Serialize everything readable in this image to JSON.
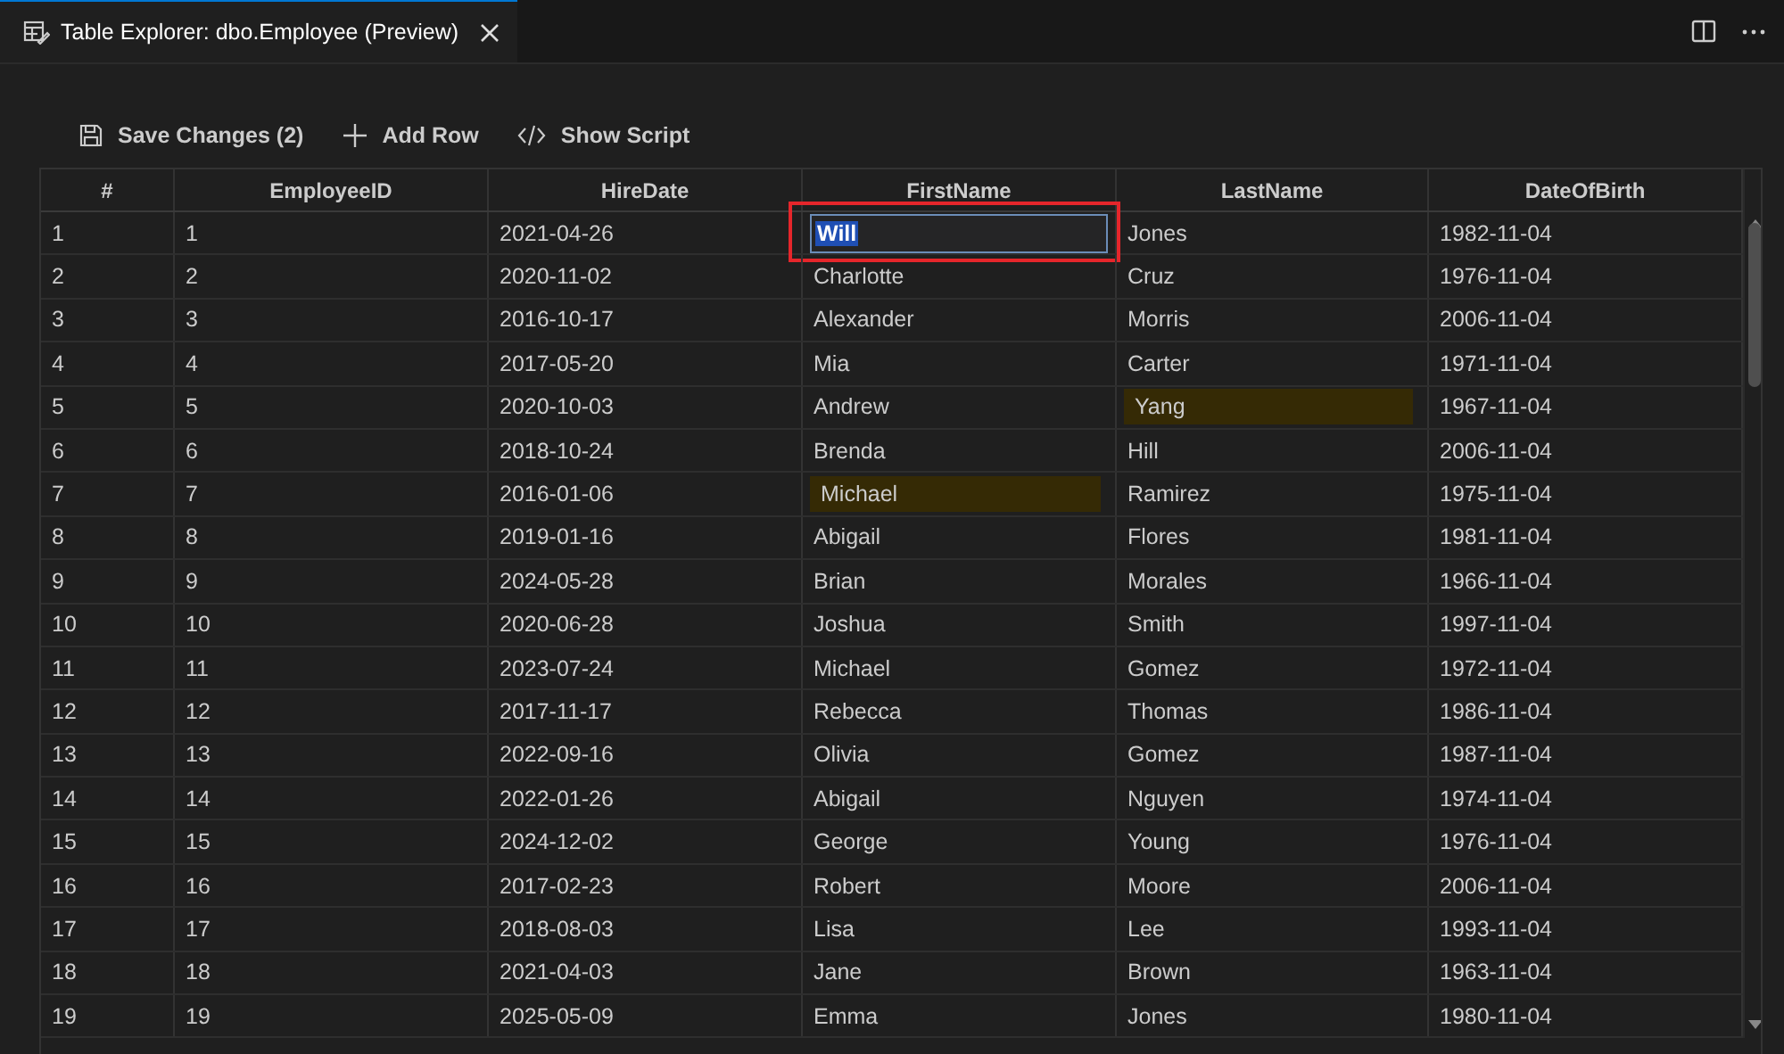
{
  "tab": {
    "title": "Table Explorer: dbo.Employee (Preview)",
    "selected": true
  },
  "toolbar": [
    {
      "kind": "save",
      "label": "Save Changes (2)"
    },
    {
      "kind": "add",
      "label": "Add Row"
    },
    {
      "kind": "script",
      "label": "Show Script"
    }
  ],
  "table": {
    "columns": [
      "#",
      "EmployeeID",
      "HireDate",
      "FirstName",
      "LastName",
      "DateOfBirth"
    ],
    "rows": [
      [
        {
          "text": "1",
          "kind": "plain"
        },
        {
          "text": "1",
          "kind": "plain"
        },
        {
          "text": "2021-04-26",
          "kind": "plain"
        },
        {
          "text": "Will",
          "kind": "editing",
          "annotated": true
        },
        {
          "text": "Jones",
          "kind": "plain"
        },
        {
          "text": "1982-11-04",
          "kind": "plain"
        }
      ],
      [
        {
          "text": "2",
          "kind": "plain"
        },
        {
          "text": "2",
          "kind": "plain"
        },
        {
          "text": "2020-11-02",
          "kind": "plain"
        },
        {
          "text": "Charlotte",
          "kind": "plain"
        },
        {
          "text": "Cruz",
          "kind": "plain"
        },
        {
          "text": "1976-11-04",
          "kind": "plain"
        }
      ],
      [
        {
          "text": "3",
          "kind": "plain"
        },
        {
          "text": "3",
          "kind": "plain"
        },
        {
          "text": "2016-10-17",
          "kind": "plain"
        },
        {
          "text": "Alexander",
          "kind": "plain"
        },
        {
          "text": "Morris",
          "kind": "plain"
        },
        {
          "text": "2006-11-04",
          "kind": "plain"
        }
      ],
      [
        {
          "text": "4",
          "kind": "plain"
        },
        {
          "text": "4",
          "kind": "plain"
        },
        {
          "text": "2017-05-20",
          "kind": "plain"
        },
        {
          "text": "Mia",
          "kind": "plain"
        },
        {
          "text": "Carter",
          "kind": "plain"
        },
        {
          "text": "1971-11-04",
          "kind": "plain"
        }
      ],
      [
        {
          "text": "5",
          "kind": "plain"
        },
        {
          "text": "5",
          "kind": "plain"
        },
        {
          "text": "2020-10-03",
          "kind": "plain"
        },
        {
          "text": "Andrew",
          "kind": "plain"
        },
        {
          "text": "Yang",
          "kind": "modified"
        },
        {
          "text": "1967-11-04",
          "kind": "plain"
        }
      ],
      [
        {
          "text": "6",
          "kind": "plain"
        },
        {
          "text": "6",
          "kind": "plain"
        },
        {
          "text": "2018-10-24",
          "kind": "plain"
        },
        {
          "text": "Brenda",
          "kind": "plain"
        },
        {
          "text": "Hill",
          "kind": "plain"
        },
        {
          "text": "2006-11-04",
          "kind": "plain"
        }
      ],
      [
        {
          "text": "7",
          "kind": "plain"
        },
        {
          "text": "7",
          "kind": "plain"
        },
        {
          "text": "2016-01-06",
          "kind": "plain"
        },
        {
          "text": "Michael",
          "kind": "modified"
        },
        {
          "text": "Ramirez",
          "kind": "plain"
        },
        {
          "text": "1975-11-04",
          "kind": "plain"
        }
      ],
      [
        {
          "text": "8",
          "kind": "plain"
        },
        {
          "text": "8",
          "kind": "plain"
        },
        {
          "text": "2019-01-16",
          "kind": "plain"
        },
        {
          "text": "Abigail",
          "kind": "plain"
        },
        {
          "text": "Flores",
          "kind": "plain"
        },
        {
          "text": "1981-11-04",
          "kind": "plain"
        }
      ],
      [
        {
          "text": "9",
          "kind": "plain"
        },
        {
          "text": "9",
          "kind": "plain"
        },
        {
          "text": "2024-05-28",
          "kind": "plain"
        },
        {
          "text": "Brian",
          "kind": "plain"
        },
        {
          "text": "Morales",
          "kind": "plain"
        },
        {
          "text": "1966-11-04",
          "kind": "plain"
        }
      ],
      [
        {
          "text": "10",
          "kind": "plain"
        },
        {
          "text": "10",
          "kind": "plain"
        },
        {
          "text": "2020-06-28",
          "kind": "plain"
        },
        {
          "text": "Joshua",
          "kind": "plain"
        },
        {
          "text": "Smith",
          "kind": "plain"
        },
        {
          "text": "1997-11-04",
          "kind": "plain"
        }
      ],
      [
        {
          "text": "11",
          "kind": "plain"
        },
        {
          "text": "11",
          "kind": "plain"
        },
        {
          "text": "2023-07-24",
          "kind": "plain"
        },
        {
          "text": "Michael",
          "kind": "plain"
        },
        {
          "text": "Gomez",
          "kind": "plain"
        },
        {
          "text": "1972-11-04",
          "kind": "plain"
        }
      ],
      [
        {
          "text": "12",
          "kind": "plain"
        },
        {
          "text": "12",
          "kind": "plain"
        },
        {
          "text": "2017-11-17",
          "kind": "plain"
        },
        {
          "text": "Rebecca",
          "kind": "plain"
        },
        {
          "text": "Thomas",
          "kind": "plain"
        },
        {
          "text": "1986-11-04",
          "kind": "plain"
        }
      ],
      [
        {
          "text": "13",
          "kind": "plain"
        },
        {
          "text": "13",
          "kind": "plain"
        },
        {
          "text": "2022-09-16",
          "kind": "plain"
        },
        {
          "text": "Olivia",
          "kind": "plain"
        },
        {
          "text": "Gomez",
          "kind": "plain"
        },
        {
          "text": "1987-11-04",
          "kind": "plain"
        }
      ],
      [
        {
          "text": "14",
          "kind": "plain"
        },
        {
          "text": "14",
          "kind": "plain"
        },
        {
          "text": "2022-01-26",
          "kind": "plain"
        },
        {
          "text": "Abigail",
          "kind": "plain"
        },
        {
          "text": "Nguyen",
          "kind": "plain"
        },
        {
          "text": "1974-11-04",
          "kind": "plain"
        }
      ],
      [
        {
          "text": "15",
          "kind": "plain"
        },
        {
          "text": "15",
          "kind": "plain"
        },
        {
          "text": "2024-12-02",
          "kind": "plain"
        },
        {
          "text": "George",
          "kind": "plain"
        },
        {
          "text": "Young",
          "kind": "plain"
        },
        {
          "text": "1976-11-04",
          "kind": "plain"
        }
      ],
      [
        {
          "text": "16",
          "kind": "plain"
        },
        {
          "text": "16",
          "kind": "plain"
        },
        {
          "text": "2017-02-23",
          "kind": "plain"
        },
        {
          "text": "Robert",
          "kind": "plain"
        },
        {
          "text": "Moore",
          "kind": "plain"
        },
        {
          "text": "2006-11-04",
          "kind": "plain"
        }
      ],
      [
        {
          "text": "17",
          "kind": "plain"
        },
        {
          "text": "17",
          "kind": "plain"
        },
        {
          "text": "2018-08-03",
          "kind": "plain"
        },
        {
          "text": "Lisa",
          "kind": "plain"
        },
        {
          "text": "Lee",
          "kind": "plain"
        },
        {
          "text": "1993-11-04",
          "kind": "plain"
        }
      ],
      [
        {
          "text": "18",
          "kind": "plain"
        },
        {
          "text": "18",
          "kind": "plain"
        },
        {
          "text": "2021-04-03",
          "kind": "plain"
        },
        {
          "text": "Jane",
          "kind": "plain"
        },
        {
          "text": "Brown",
          "kind": "plain"
        },
        {
          "text": "1963-11-04",
          "kind": "plain"
        }
      ],
      [
        {
          "text": "19",
          "kind": "plain"
        },
        {
          "text": "19",
          "kind": "plain"
        },
        {
          "text": "2025-05-09",
          "kind": "plain"
        },
        {
          "text": "Emma",
          "kind": "plain"
        },
        {
          "text": "Jones",
          "kind": "plain"
        },
        {
          "text": "1980-11-04",
          "kind": "plain"
        }
      ]
    ]
  }
}
